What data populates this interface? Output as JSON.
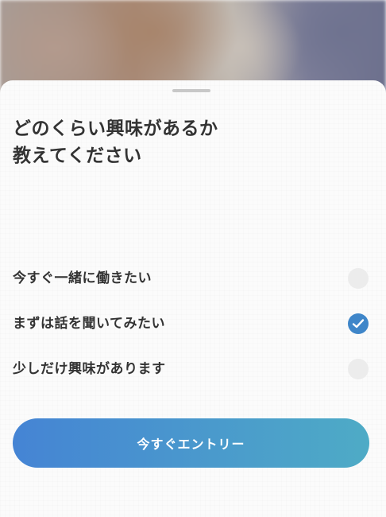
{
  "sheet": {
    "title_lines": [
      "どのくらい興味があるか",
      "教えてください"
    ]
  },
  "options": [
    {
      "label": "今すぐ一緒に働きたい",
      "selected": false
    },
    {
      "label": "まずは話を聞いてみたい",
      "selected": true
    },
    {
      "label": "少しだけ興味があります",
      "selected": false
    }
  ],
  "entry_button": {
    "label": "今すぐエントリー"
  },
  "colors": {
    "accent": "#3f86c9",
    "button_gradient_start": "#4584d4",
    "button_gradient_end": "#4eabc6",
    "text": "#333333",
    "unchecked_radio": "#ececec"
  },
  "icons": {
    "checkmark": "check-icon",
    "sheet_handle": "drag-handle"
  }
}
